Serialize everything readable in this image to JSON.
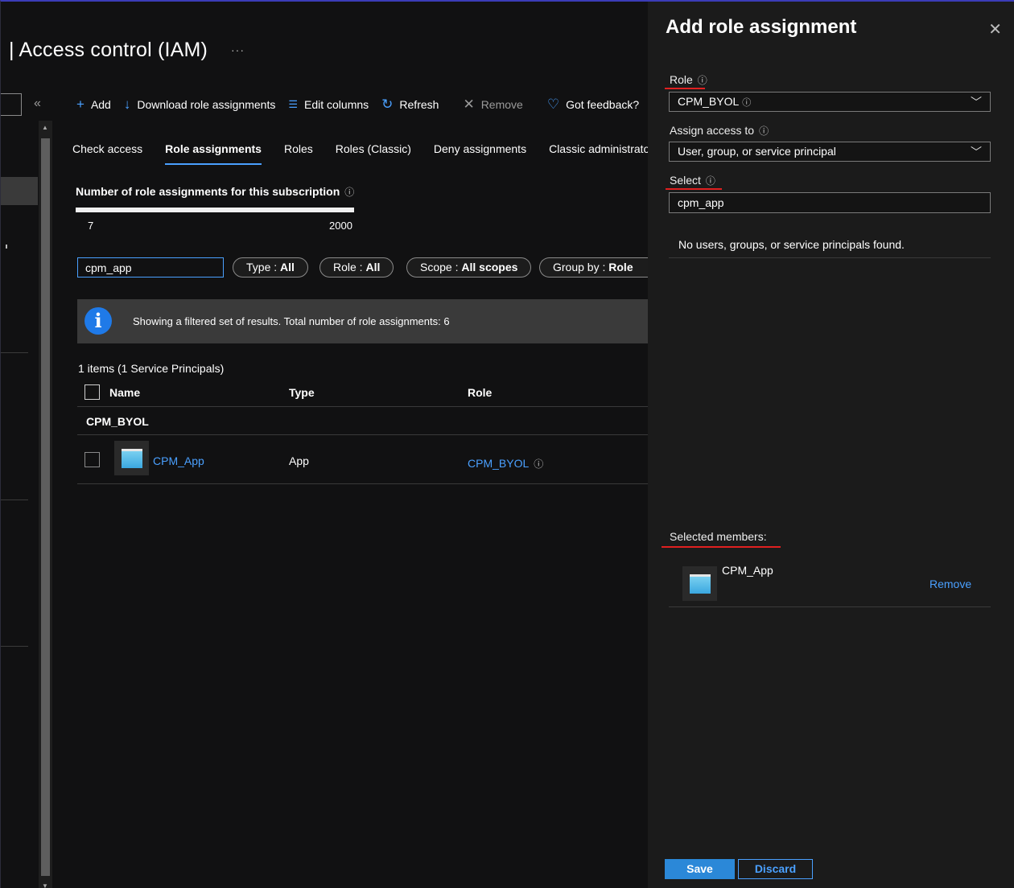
{
  "header": {
    "title": "| Access control (IAM)",
    "more": "···",
    "collapse": "«"
  },
  "toolbar": {
    "add": "Add",
    "download": "Download role assignments",
    "edit_columns": "Edit columns",
    "refresh": "Refresh",
    "remove": "Remove",
    "feedback": "Got feedback?"
  },
  "tabs": [
    "Check access",
    "Role assignments",
    "Roles",
    "Roles (Classic)",
    "Deny assignments",
    "Classic administrators"
  ],
  "summary": {
    "label": "Number of role assignments for this subscription",
    "current": "7",
    "max": "2000",
    "progress_fraction": 0.0035
  },
  "filters": {
    "search_value": "cpm_app",
    "type_label": "Type : ",
    "type_value": "All",
    "role_label": "Role : ",
    "role_value": "All",
    "scope_label": "Scope : ",
    "scope_value": "All scopes",
    "group_label": "Group by : ",
    "group_value": "Role"
  },
  "info_banner": {
    "icon": "i",
    "text": "Showing a filtered set of results. Total number of role assignments: 6"
  },
  "table": {
    "count": "1 items (1 Service Principals)",
    "headers": {
      "name": "Name",
      "type": "Type",
      "role": "Role"
    },
    "group": "CPM_BYOL",
    "rows": [
      {
        "name": "CPM_App",
        "type": "App",
        "role": "CPM_BYOL"
      }
    ]
  },
  "panel": {
    "title": "Add role assignment",
    "close": "✕",
    "role_label": "Role",
    "role_value": "CPM_BYOL",
    "assign_label": "Assign access to",
    "assign_value": "User, group, or service principal",
    "select_label": "Select",
    "select_value": "cpm_app",
    "no_results": "No users, groups, or service principals found.",
    "selected_label": "Selected members:",
    "selected_member": "CPM_App",
    "remove": "Remove",
    "save": "Save",
    "discard": "Discard"
  },
  "colors": {
    "accent": "#4aa0ff",
    "primary_button": "#2b88d8",
    "annotation_red": "#e02020",
    "background": "#111112",
    "panel_background": "#1b1b1b"
  }
}
